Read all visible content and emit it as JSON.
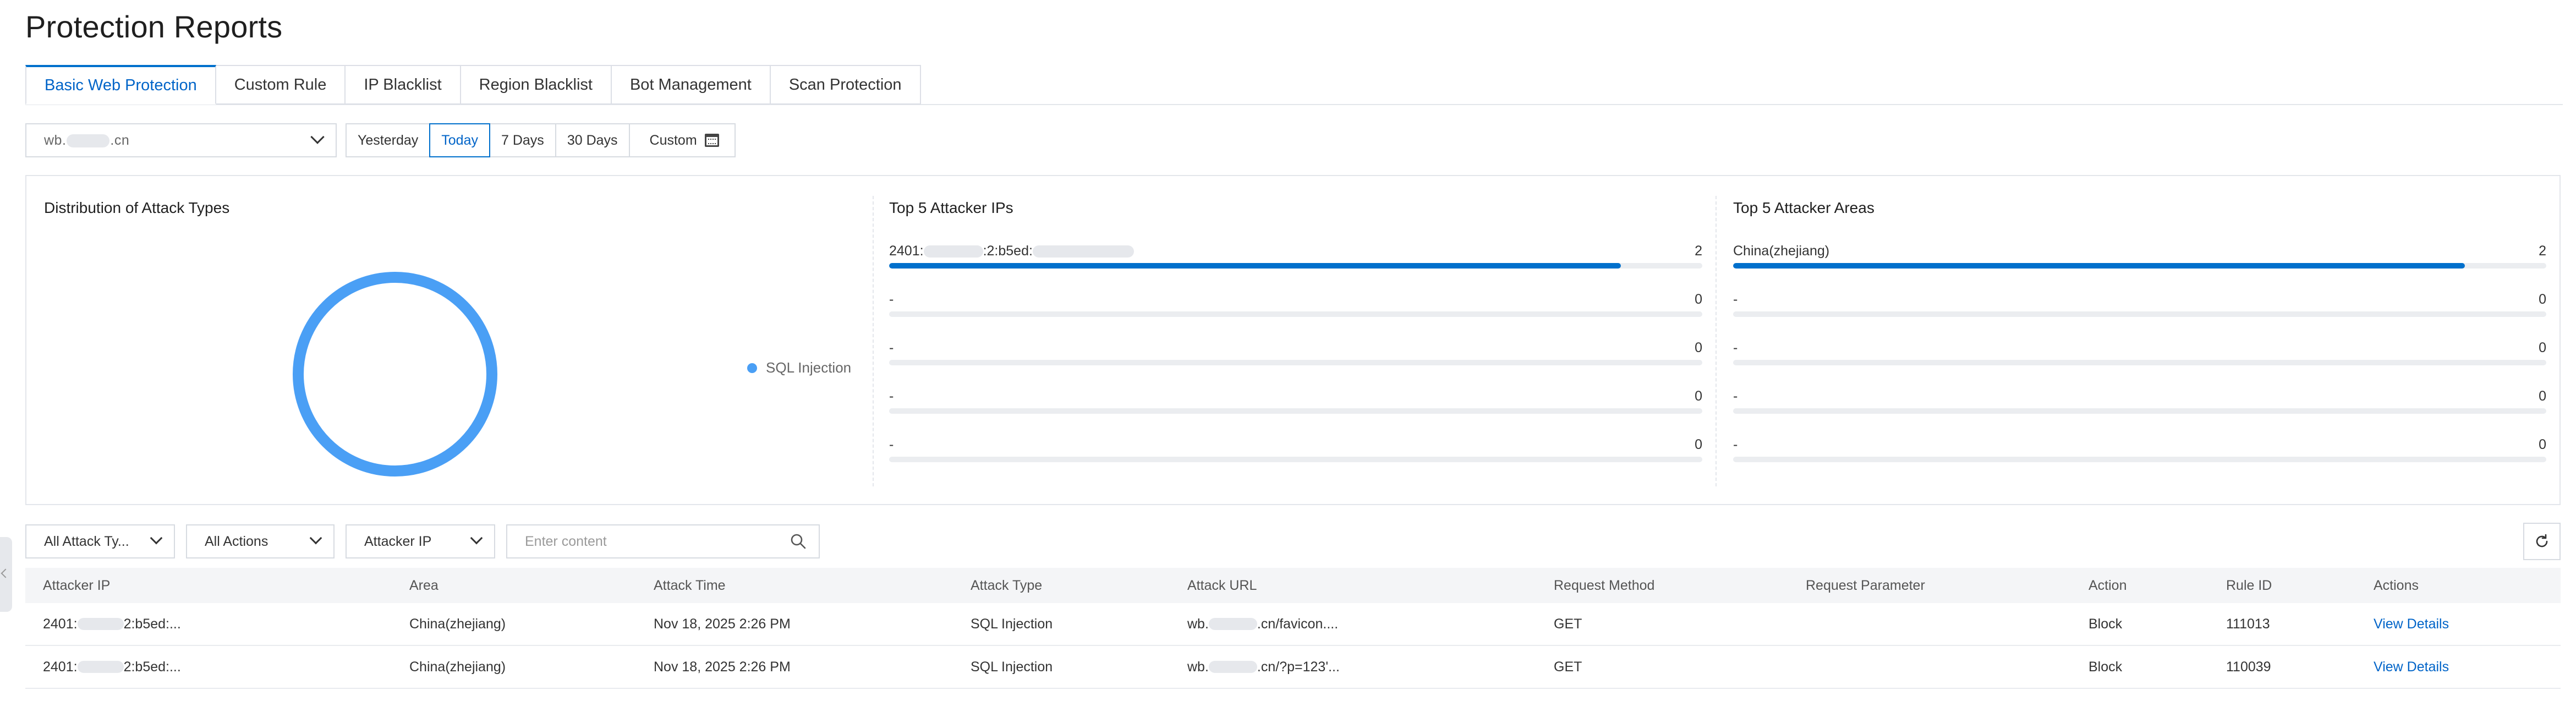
{
  "page": {
    "title": "Protection Reports"
  },
  "tabs": [
    {
      "label": "Basic Web Protection",
      "active": true
    },
    {
      "label": "Custom Rule",
      "active": false
    },
    {
      "label": "IP Blacklist",
      "active": false
    },
    {
      "label": "Region Blacklist",
      "active": false
    },
    {
      "label": "Bot Management",
      "active": false
    },
    {
      "label": "Scan Protection",
      "active": false
    }
  ],
  "domain": {
    "prefix": "wb.",
    "suffix": ".cn"
  },
  "time_range": {
    "options": [
      "Yesterday",
      "Today",
      "7 Days",
      "30 Days",
      "Custom"
    ],
    "selected": "Today"
  },
  "attack_distribution": {
    "title": "Distribution of Attack Types",
    "legend": [
      {
        "label": "SQL Injection",
        "color": "#4a9ff5"
      }
    ]
  },
  "chart_data": {
    "type": "pie",
    "categories": [
      "SQL Injection"
    ],
    "values": [
      2
    ],
    "colors": [
      "#4a9ff5"
    ],
    "title": "Distribution of Attack Types"
  },
  "top_ips": {
    "title": "Top 5 Attacker IPs",
    "items": [
      {
        "label_prefix": "2401:",
        "label_mid": ":2:b5ed:",
        "masked": true,
        "count": "2",
        "fraction": 0.9
      },
      {
        "label": "-",
        "count": "0",
        "fraction": 0
      },
      {
        "label": "-",
        "count": "0",
        "fraction": 0
      },
      {
        "label": "-",
        "count": "0",
        "fraction": 0
      },
      {
        "label": "-",
        "count": "0",
        "fraction": 0
      }
    ]
  },
  "top_areas": {
    "title": "Top 5 Attacker Areas",
    "items": [
      {
        "label": "China(zhejiang)",
        "count": "2",
        "fraction": 0.9
      },
      {
        "label": "-",
        "count": "0",
        "fraction": 0
      },
      {
        "label": "-",
        "count": "0",
        "fraction": 0
      },
      {
        "label": "-",
        "count": "0",
        "fraction": 0
      },
      {
        "label": "-",
        "count": "0",
        "fraction": 0
      }
    ]
  },
  "filters": {
    "attack_type": "All Attack Ty...",
    "action": "All Actions",
    "field": "Attacker IP",
    "search_placeholder": "Enter content"
  },
  "table": {
    "columns": [
      "Attacker IP",
      "Area",
      "Attack Time",
      "Attack Type",
      "Attack URL",
      "Request Method",
      "Request Parameter",
      "Action",
      "Rule ID",
      "Actions"
    ],
    "rows": [
      {
        "ip_prefix": "2401:",
        "ip_suffix": "2:b5ed:...",
        "area": "China(zhejiang)",
        "time": "Nov 18, 2025 2:26 PM",
        "type": "SQL Injection",
        "url_prefix": "wb.",
        "url_suffix": ".cn/favicon....",
        "method": "GET",
        "param": "",
        "action": "Block",
        "rule_id": "111013",
        "link": "View Details"
      },
      {
        "ip_prefix": "2401:",
        "ip_suffix": "2:b5ed:...",
        "area": "China(zhejiang)",
        "time": "Nov 18, 2025 2:26 PM",
        "type": "SQL Injection",
        "url_prefix": "wb.",
        "url_suffix": ".cn/?p=123'...",
        "method": "GET",
        "param": "",
        "action": "Block",
        "rule_id": "110039",
        "link": "View Details"
      }
    ]
  },
  "colors": {
    "accent": "#0070cc",
    "bar": "#0070cc",
    "donut": "#4a9ff5"
  }
}
